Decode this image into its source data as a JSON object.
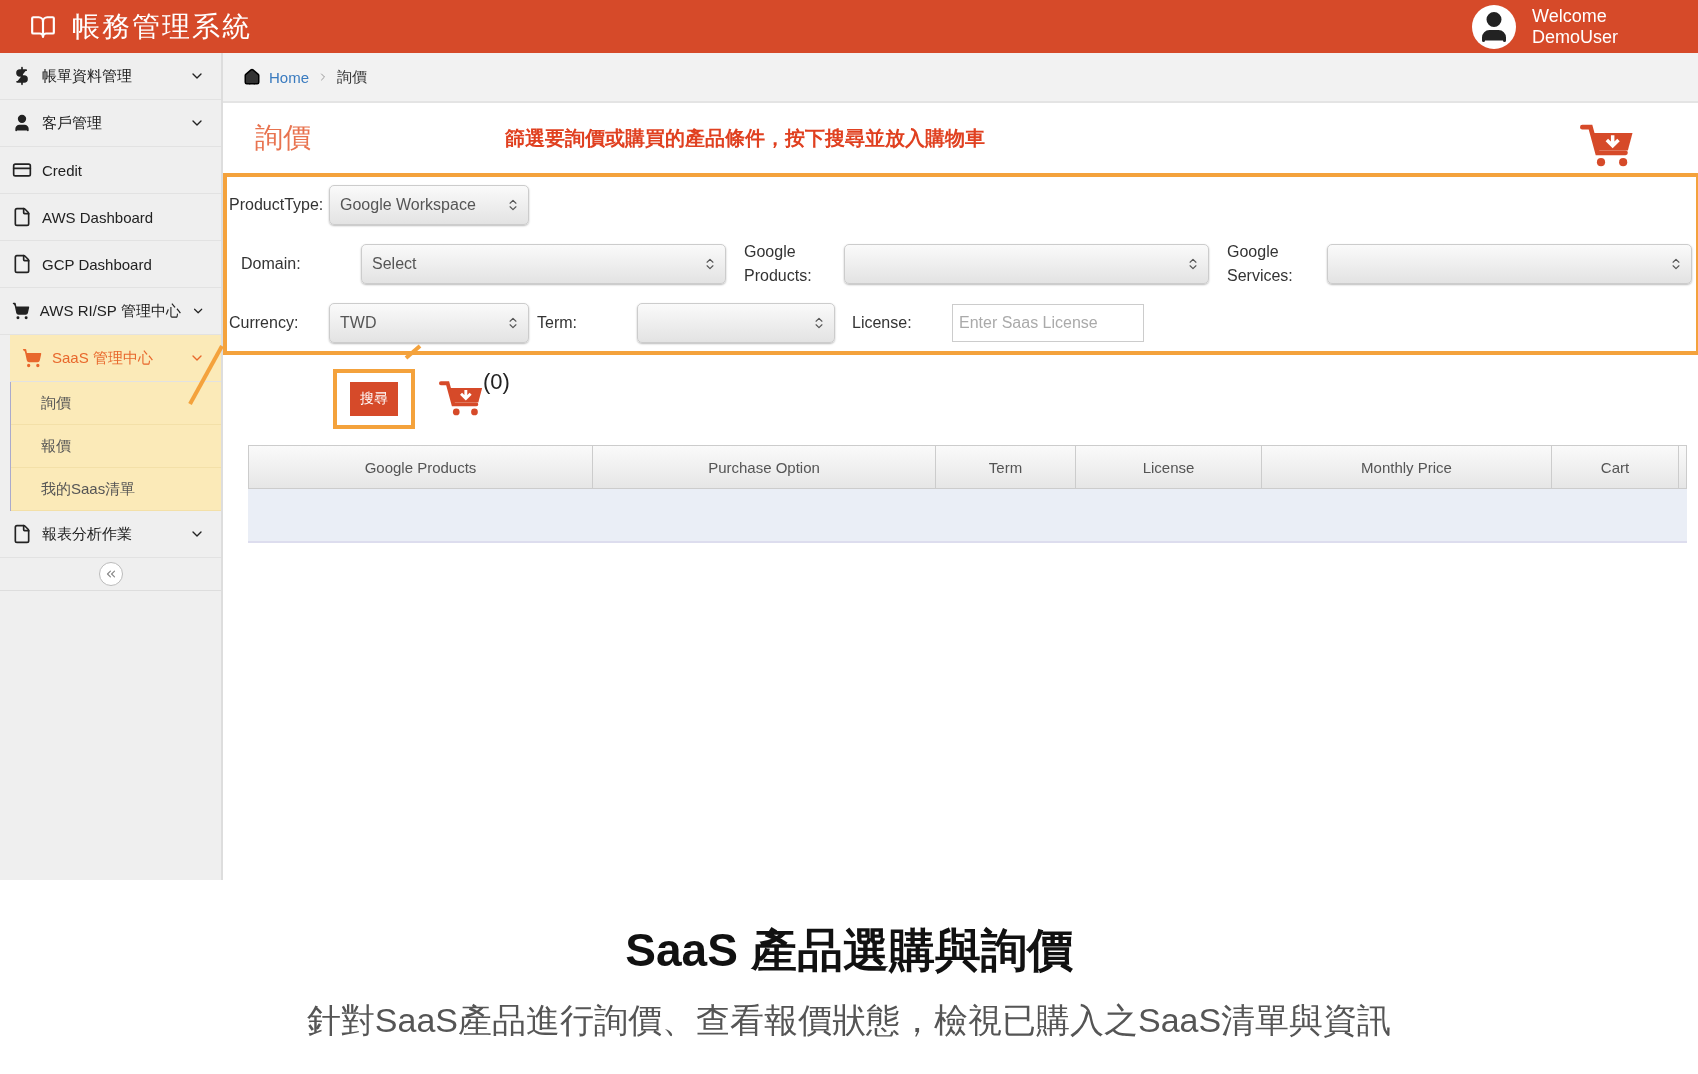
{
  "header": {
    "title": "帳務管理系統",
    "user": [
      "Welcome",
      "DemoUser"
    ]
  },
  "sidebar": {
    "items": [
      {
        "label": "帳單資料管理",
        "kind": "group",
        "selected": false
      },
      {
        "label": "客戶管理",
        "kind": "group",
        "selected": false
      },
      {
        "label": "Credit",
        "kind": "link",
        "selected": false
      },
      {
        "label": "AWS Dashboard",
        "kind": "link",
        "selected": false
      },
      {
        "label": "GCP Dashboard",
        "kind": "link",
        "selected": false
      },
      {
        "label": "AWS RI/SP 管理中心",
        "kind": "group",
        "selected": false
      },
      {
        "label": "SaaS 管理中心",
        "kind": "group",
        "selected": true,
        "children": [
          {
            "label": "詢價"
          },
          {
            "label": "報價"
          },
          {
            "label": "我的Saas清單"
          }
        ]
      },
      {
        "label": "報表分析作業",
        "kind": "group",
        "selected": false
      }
    ]
  },
  "breadcrumb": [
    "Home",
    "詢價"
  ],
  "page_title": "詢價",
  "instruction": "篩選要詢價或購買的產品條件，按下搜尋並放入購物車",
  "form": {
    "rows": [
      [
        {
          "label": "ProductType:",
          "kind": "select",
          "value": "Google Workspace"
        }
      ],
      [
        {
          "label": "Domain:",
          "kind": "select",
          "value": "Select"
        },
        {
          "label": "Google Products:",
          "kind": "select"
        },
        {
          "label": "Google Services:",
          "kind": "select"
        }
      ],
      [
        {
          "label": "Currency:",
          "kind": "select",
          "value": "TWD"
        },
        {
          "label": "Term:",
          "kind": "select"
        },
        {
          "label": "License:",
          "kind": "input",
          "placeholder": "Enter Saas License"
        }
      ]
    ]
  },
  "search_button": "搜尋",
  "cart_count": "(0)",
  "table": {
    "columns": [
      "Google Products",
      "Purchase Option",
      "Term",
      "License",
      "Monthly Price",
      "Cart"
    ]
  },
  "caption": {
    "title": "SaaS 產品選購與詢價",
    "subtitle": "針對SaaS產品進行詢價、查看報價狀態，檢視已購入之SaaS清單與資訊"
  }
}
